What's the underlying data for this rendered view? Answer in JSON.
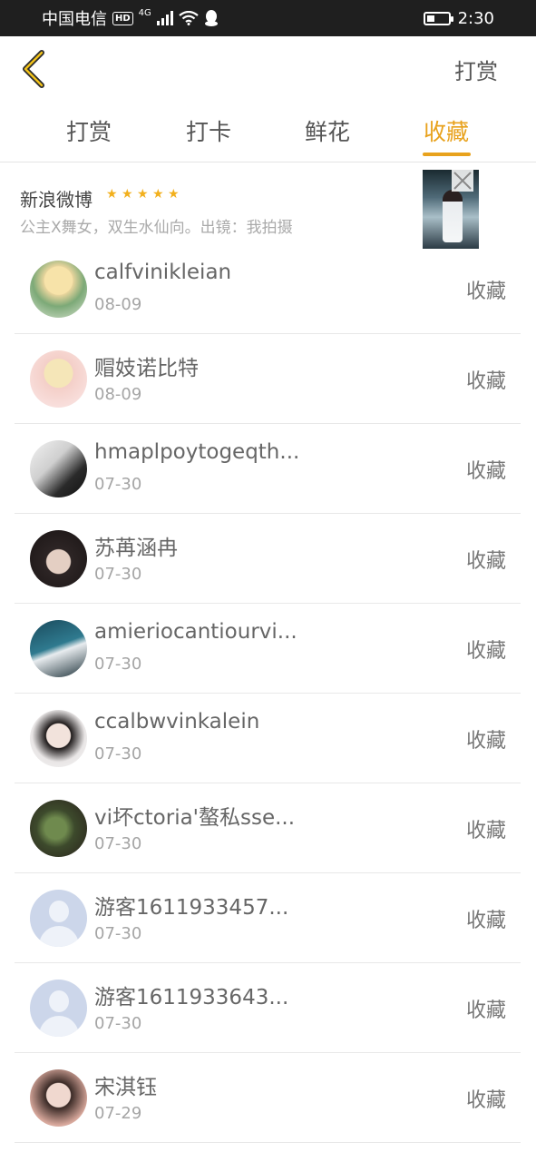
{
  "status_bar": {
    "carrier": "中国电信",
    "hd": "HD",
    "network": "4G",
    "time": "2:30",
    "battery_level": 0.35
  },
  "header": {
    "back_icon": "chevron-left-icon",
    "action_label": "打赏",
    "accent_color": "#e8a21d"
  },
  "tabs": [
    {
      "label": "打赏",
      "active": false
    },
    {
      "label": "打卡",
      "active": false
    },
    {
      "label": "鲜花",
      "active": false
    },
    {
      "label": "收藏",
      "active": true
    }
  ],
  "ad": {
    "title": "新浪微博",
    "stars": "★ ★ ★ ★ ★",
    "description": "公主X舞女，双生水仙向。出镜：我拍摄"
  },
  "favorites": [
    {
      "name": "calfvinikleian",
      "date": "08-09",
      "action": "收藏"
    },
    {
      "name": "赗妓诺比特",
      "date": "08-09",
      "action": "收藏"
    },
    {
      "name": "hmaplpoytogeqth...",
      "date": "07-30",
      "action": "收藏"
    },
    {
      "name": "苏苒涵冉",
      "date": "07-30",
      "action": "收藏"
    },
    {
      "name": "amieriocantiourvi...",
      "date": "07-30",
      "action": "收藏"
    },
    {
      "name": "ccalbwvinkalein",
      "date": "07-30",
      "action": "收藏"
    },
    {
      "name": "vi坏ctoria'螯私sse...",
      "date": "07-30",
      "action": "收藏"
    },
    {
      "name": "游客1611933457...",
      "date": "07-30",
      "action": "收藏"
    },
    {
      "name": "游客1611933643...",
      "date": "07-30",
      "action": "收藏"
    },
    {
      "name": "宋淇钰",
      "date": "07-29",
      "action": "收藏"
    }
  ]
}
